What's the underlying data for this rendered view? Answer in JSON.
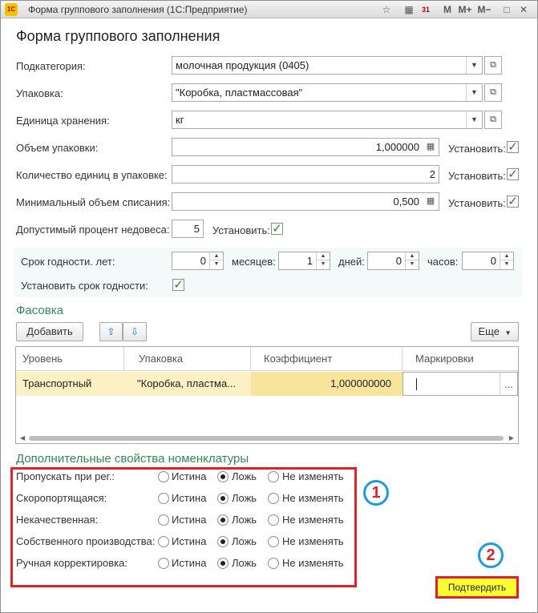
{
  "window": {
    "title": "Форма группового заполнения  (1С:Предприятие)",
    "app_icon": "1C",
    "buttons": [
      "☆",
      "▦",
      "31",
      "M",
      "M+",
      "M−",
      "□",
      "✕"
    ]
  },
  "form": {
    "title": "Форма группового заполнения"
  },
  "fields": {
    "subcategory": {
      "label": "Подкатегория:",
      "value": "молочная продукция (0405)"
    },
    "packaging": {
      "label": "Упаковка:",
      "value": "\"Коробка, пластмассовая\""
    },
    "storage_unit": {
      "label": "Единица хранения:",
      "value": "кг"
    },
    "pack_volume": {
      "label": "Объем упаковки:",
      "value": "1,000000",
      "set_label": "Установить:",
      "set_checked": true
    },
    "units_in_pack": {
      "label": "Количество единиц в упаковке:",
      "value": "2",
      "set_label": "Установить:",
      "set_checked": true
    },
    "min_writeoff": {
      "label": "Минимальный объем списания:",
      "value": "0,500",
      "set_label": "Установить:",
      "set_checked": true
    },
    "underweight": {
      "label": "Допустимый процент недовеса:",
      "value": "5",
      "set_label": "Установить:",
      "set_checked": true
    }
  },
  "shelf_life": {
    "years_label": "Срок годности. лет:",
    "years": "0",
    "months_label": "месяцев:",
    "months": "1",
    "days_label": "дней:",
    "days": "0",
    "hours_label": "часов:",
    "hours": "0",
    "set_label": "Установить срок годности:",
    "set_checked": true
  },
  "packing": {
    "section_title": "Фасовка",
    "add_button": "Добавить",
    "more_button": "Еще",
    "columns": [
      "Уровень",
      "Упаковка",
      "Коэффициент",
      "Маркировки"
    ],
    "rows": [
      {
        "level": "Транспортный",
        "package": "\"Коробка, пластма...",
        "coef": "1,000000000",
        "marking": ""
      }
    ]
  },
  "extra": {
    "section_title": "Дополнительные свойства номенклатуры",
    "options": [
      "Истина",
      "Ложь",
      "Не изменять"
    ],
    "properties": [
      {
        "label": "Пропускать при рег.:",
        "selected": 1
      },
      {
        "label": "Скоропортящаяся:",
        "selected": 1
      },
      {
        "label": "Некачественная:",
        "selected": 1
      },
      {
        "label": "Собственного производства:",
        "selected": 1
      },
      {
        "label": "Ручная корректировка:",
        "selected": 1
      }
    ]
  },
  "annotations": {
    "badge1": "1",
    "badge2": "2"
  },
  "confirm_button": "Подтвердить",
  "colors": {
    "accent_green": "#2e8b57",
    "highlight_red": "#e3202a",
    "badge_blue": "#1e9be0",
    "confirm_yellow": "#ffff33"
  }
}
